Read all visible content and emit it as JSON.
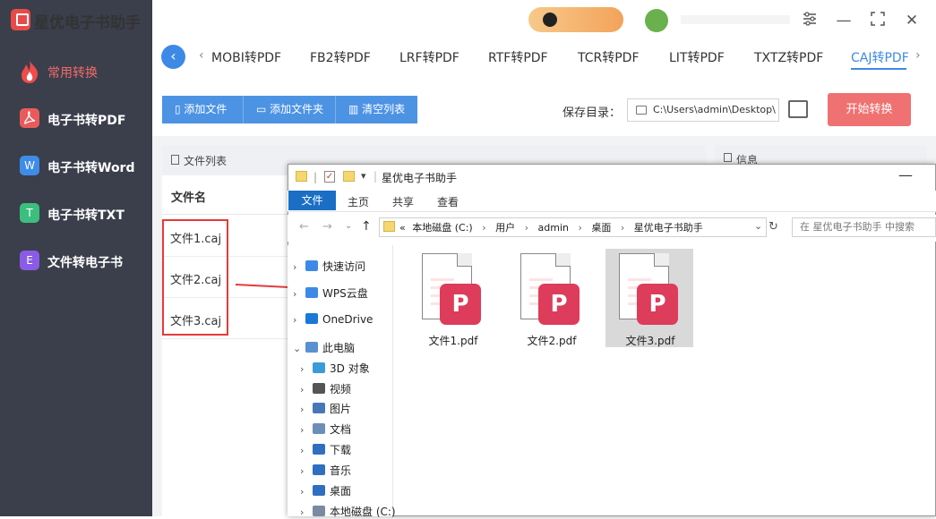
{
  "app": {
    "title": "星优电子书助手"
  },
  "sidebar": {
    "items": [
      {
        "label": "常用转换",
        "icon": "fire-icon",
        "active": true
      },
      {
        "label": "电子书转PDF",
        "icon": "pdf-icon"
      },
      {
        "label": "电子书转Word",
        "icon": "word-icon",
        "glyph": "W"
      },
      {
        "label": "电子书转TXT",
        "icon": "txt-icon",
        "glyph": "T"
      },
      {
        "label": "文件转电子书",
        "icon": "ebook-icon",
        "glyph": "E"
      }
    ]
  },
  "formats": {
    "tabs": [
      "MOBI转PDF",
      "FB2转PDF",
      "LRF转PDF",
      "RTF转PDF",
      "TCR转PDF",
      "LIT转PDF",
      "TXTZ转PDF",
      "CAJ转PDF"
    ],
    "active": "CAJ转PDF"
  },
  "toolbar": {
    "add_file": "添加文件",
    "add_folder": "添加文件夹",
    "clear_list": "清空列表",
    "save_label": "保存目录：",
    "save_path": "C:\\Users\\admin\\Desktop\\",
    "start": "开始转换"
  },
  "filelist": {
    "header": "文件列表",
    "col_name": "文件名",
    "rows": [
      "文件1.caj",
      "文件2.caj",
      "文件3.caj"
    ]
  },
  "info": {
    "header": "信息"
  },
  "explorer": {
    "title": "星优电子书助手",
    "ribbon_tabs": [
      "文件",
      "主页",
      "共享",
      "查看"
    ],
    "breadcrumb": [
      "«",
      "本地磁盘 (C:)",
      "用户",
      "admin",
      "桌面",
      "星优电子书助手"
    ],
    "search_placeholder": "在 星优电子书助手 中搜索",
    "tree": [
      {
        "label": "快速访问",
        "level": 0,
        "chev": "›"
      },
      {
        "label": "WPS云盘",
        "level": 0,
        "chev": "›"
      },
      {
        "label": "OneDrive",
        "level": 0,
        "chev": "›"
      },
      {
        "label": "此电脑",
        "level": 0,
        "chev": "⌄"
      },
      {
        "label": "3D 对象",
        "level": 1,
        "chev": "›"
      },
      {
        "label": "视频",
        "level": 1,
        "chev": "›"
      },
      {
        "label": "图片",
        "level": 1,
        "chev": "›"
      },
      {
        "label": "文档",
        "level": 1,
        "chev": "›"
      },
      {
        "label": "下载",
        "level": 1,
        "chev": "›"
      },
      {
        "label": "音乐",
        "level": 1,
        "chev": "›"
      },
      {
        "label": "桌面",
        "level": 1,
        "chev": "›"
      },
      {
        "label": "本地磁盘 (C:)",
        "level": 1,
        "chev": "›"
      }
    ],
    "files": [
      {
        "name": "文件1.pdf"
      },
      {
        "name": "文件2.pdf"
      },
      {
        "name": "文件3.pdf",
        "selected": true
      }
    ]
  },
  "colors": {
    "sidebar": "#3b3f4b",
    "accent": "#3d8ae6",
    "start": "#f07171",
    "highlight": "#e53a3a"
  }
}
